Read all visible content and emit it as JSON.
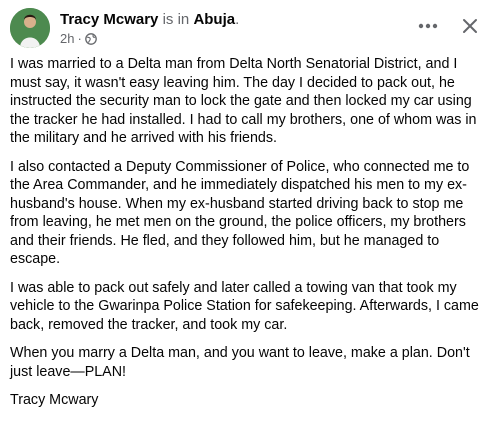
{
  "post": {
    "author": "Tracy Mcwary",
    "is_in_label": "is in",
    "location": "Abuja",
    "period": ".",
    "time": "2h",
    "dot": "·",
    "privacy_icon": "globe-icon",
    "more_icon": "more-options-icon",
    "close_icon": "close-icon",
    "paragraphs": [
      "I was married to a Delta man from Delta North Senatorial District, and I must say, it wasn't easy leaving him. The day I decided to pack out, he instructed the security man to lock the gate and then locked my car using the tracker he had installed. I had to call my brothers, one of whom was in the military and he arrived with his friends.",
      "I also contacted a Deputy Commissioner of Police, who connected me to the Area Commander, and he immediately dispatched his men to my ex-husband's house. When my ex-husband started driving back to stop me from leaving, he met men on the ground, the police officers, my brothers and their friends. He fled, and they followed him, but he managed to escape.",
      "I was able to pack out safely and later called a towing van that took my vehicle to the Gwarinpa Police Station for safekeeping. Afterwards, I came back, removed the tracker, and took my car.",
      "When you marry a Delta man, and you want to leave, make a plan. Don't just leave—PLAN!",
      "Tracy Mcwary"
    ]
  },
  "colors": {
    "text_primary": "#050505",
    "text_secondary": "#65676b",
    "background": "#ffffff"
  }
}
